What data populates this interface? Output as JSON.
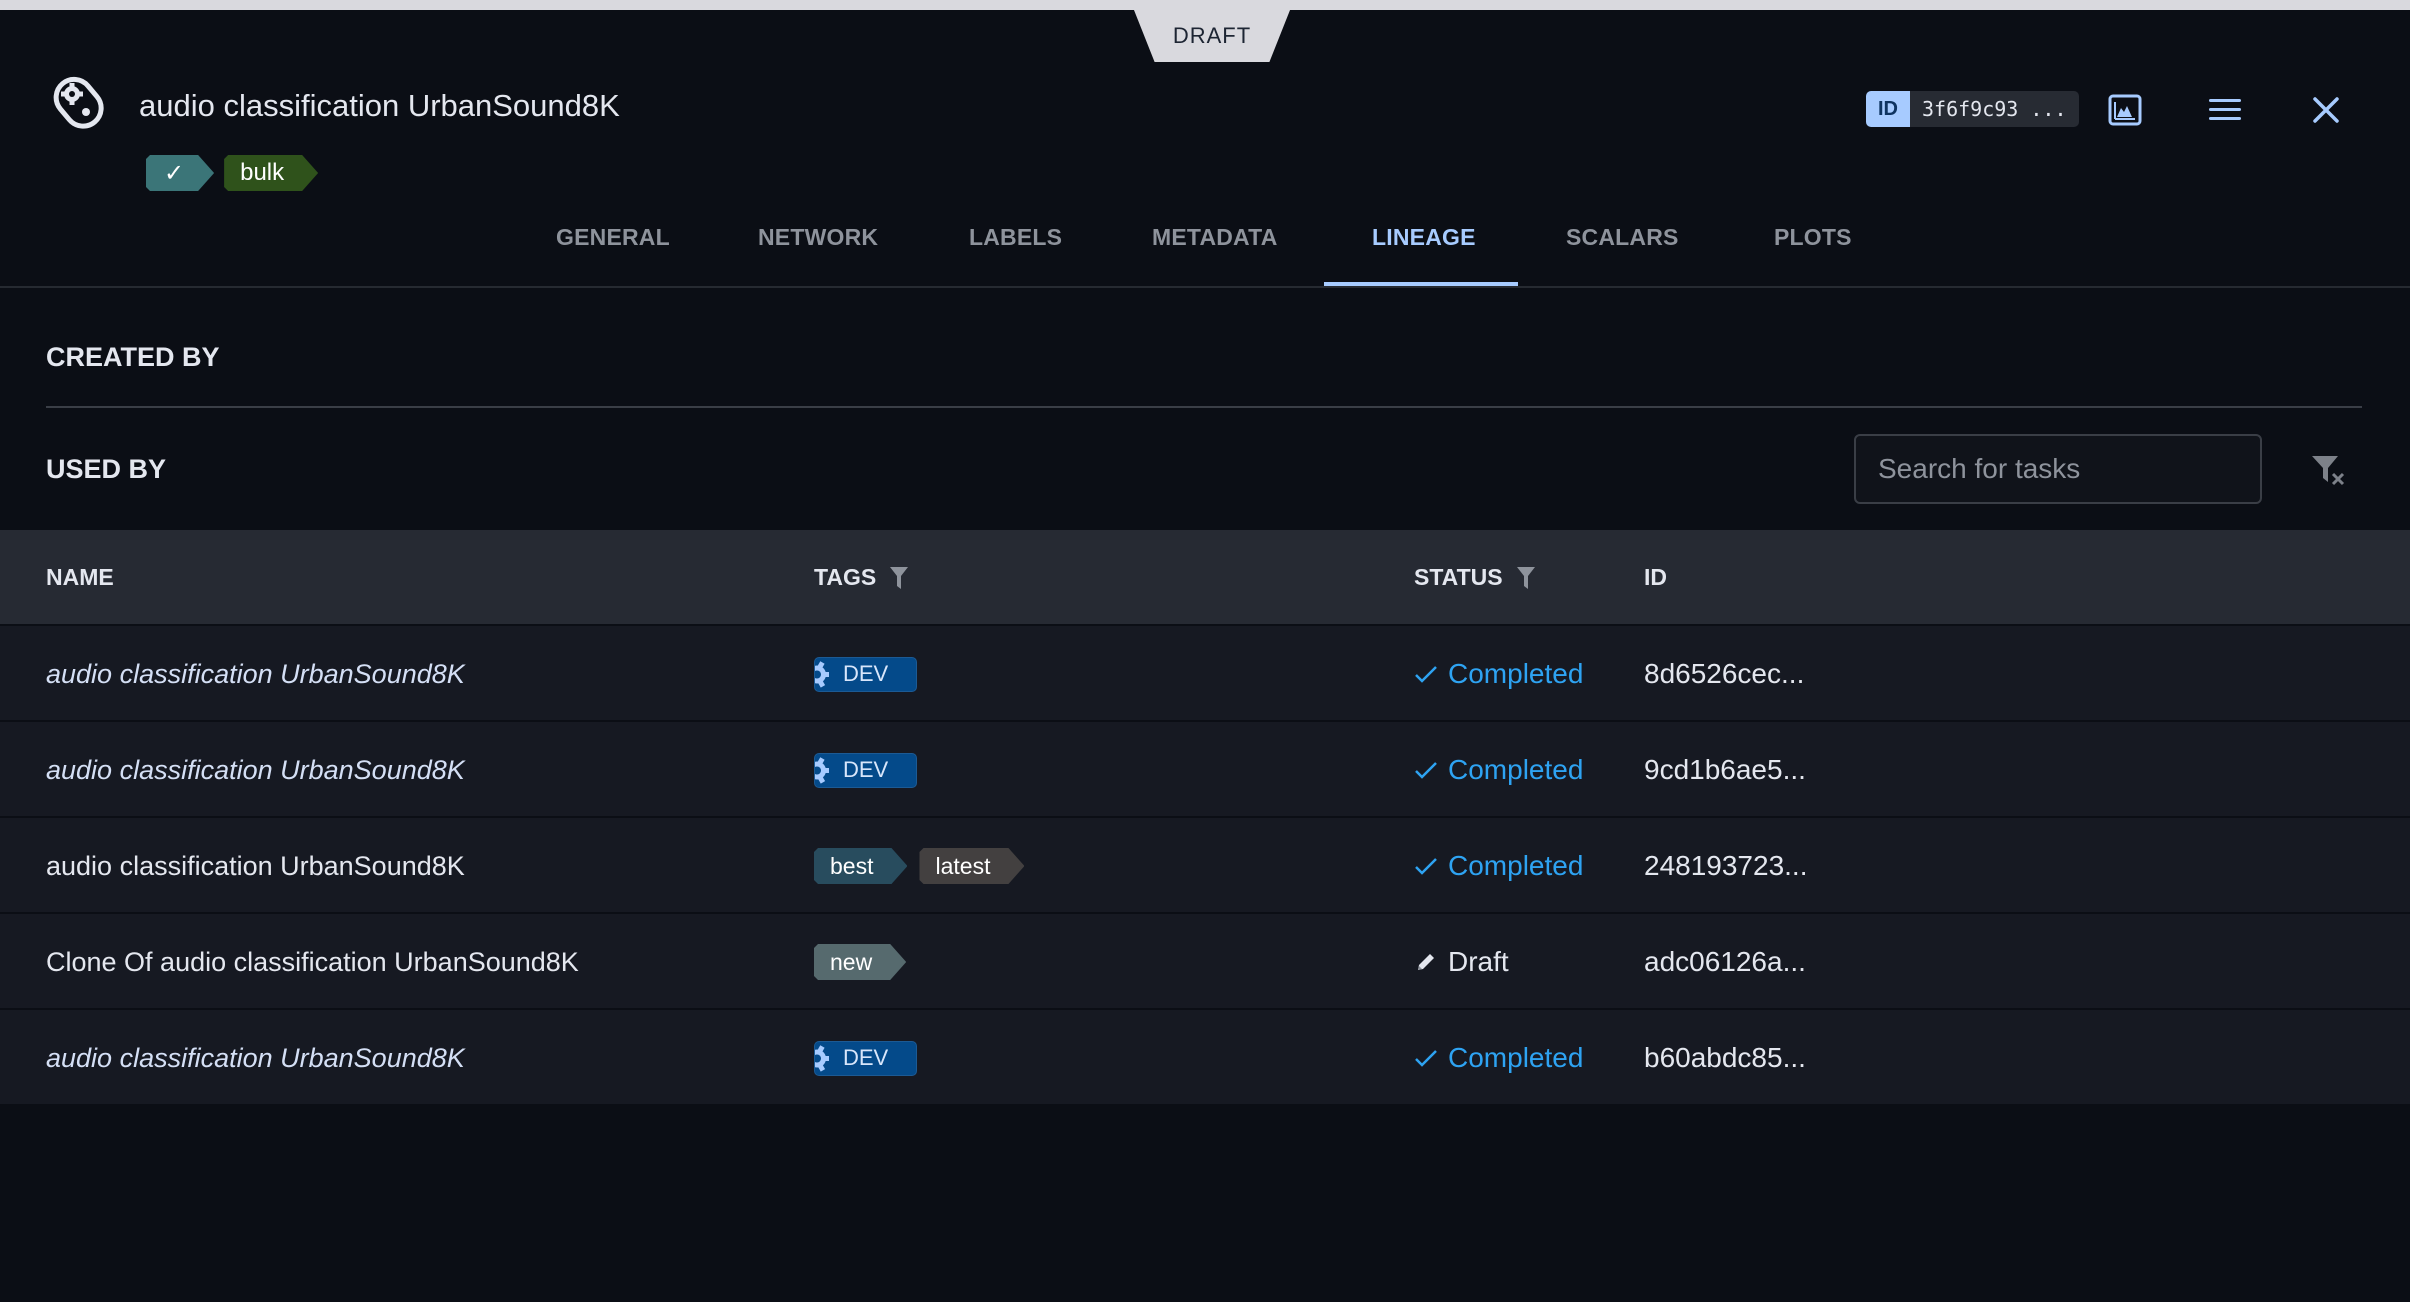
{
  "status_banner": "DRAFT",
  "header": {
    "title": "audio classification UrbanSound8K",
    "tags": [
      {
        "label": "✓",
        "color": "#3b7578"
      },
      {
        "label": "bulk",
        "color": "#2f521b"
      }
    ],
    "id_label": "ID",
    "id_value": "3f6f9c93 ...",
    "icons": [
      "experiment-icon",
      "chart-icon",
      "menu-icon",
      "close-icon"
    ]
  },
  "tabs": [
    {
      "label": "GENERAL",
      "active": false
    },
    {
      "label": "NETWORK",
      "active": false
    },
    {
      "label": "LABELS",
      "active": false
    },
    {
      "label": "METADATA",
      "active": false
    },
    {
      "label": "LINEAGE",
      "active": true
    },
    {
      "label": "SCALARS",
      "active": false
    },
    {
      "label": "PLOTS",
      "active": false
    }
  ],
  "lineage": {
    "created_by_label": "CREATED BY",
    "used_by_label": "USED BY",
    "search": {
      "placeholder": "Search for tasks",
      "value": ""
    },
    "table": {
      "columns": [
        {
          "label": "NAME",
          "filter": false
        },
        {
          "label": "TAGS",
          "filter": true
        },
        {
          "label": "STATUS",
          "filter": true
        },
        {
          "label": "ID",
          "filter": false
        }
      ],
      "rows": [
        {
          "name": "audio classification UrbanSound8K",
          "italic": true,
          "tags": [
            {
              "type": "system",
              "label": "DEV"
            }
          ],
          "status": "Completed",
          "id": "8d6526cec..."
        },
        {
          "name": "audio classification UrbanSound8K",
          "italic": true,
          "tags": [
            {
              "type": "system",
              "label": "DEV"
            }
          ],
          "status": "Completed",
          "id": "9cd1b6ae5..."
        },
        {
          "name": "audio classification UrbanSound8K",
          "italic": false,
          "tags": [
            {
              "type": "user",
              "label": "best",
              "color": "#284c5e"
            },
            {
              "type": "user",
              "label": "latest",
              "color": "#434040"
            }
          ],
          "status": "Completed",
          "id": "248193723..."
        },
        {
          "name": "Clone Of audio classification UrbanSound8K",
          "italic": false,
          "tags": [
            {
              "type": "user",
              "label": "new",
              "color": "#566a6e"
            }
          ],
          "status": "Draft",
          "id": "adc06126a..."
        },
        {
          "name": "audio classification UrbanSound8K",
          "italic": true,
          "tags": [
            {
              "type": "system",
              "label": "DEV"
            }
          ],
          "status": "Completed",
          "id": "b60abdc85..."
        }
      ]
    }
  },
  "colors": {
    "accent": "#a7cbff",
    "completed": "#2ea3f2",
    "background": "#0b0e15",
    "row": "#161922",
    "header_row": "#262a33"
  }
}
